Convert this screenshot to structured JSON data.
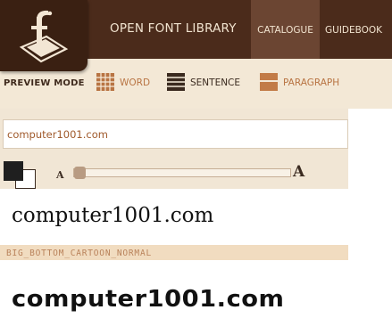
{
  "header": {
    "site_title": "OPEN FONT LIBRARY",
    "nav": [
      {
        "label": "CATALOGUE",
        "active": true
      },
      {
        "label": "GUIDEBOOK",
        "active": false
      }
    ]
  },
  "preview": {
    "mode_label": "PREVIEW MODE",
    "modes": [
      {
        "label": "WORD",
        "icon": "grid-icon"
      },
      {
        "label": "SENTENCE",
        "icon": "lines-icon"
      },
      {
        "label": "PARAGRAPH",
        "icon": "paragraph-icon"
      }
    ],
    "input_value": "computer1001.com",
    "foreground_color": "#1f1f1f",
    "background_color": "#ffffff",
    "size_small_label": "A",
    "size_large_label": "A"
  },
  "samples": {
    "default_text": "computer1001.com",
    "font_name": "BIG_BOTTOM_CARTOON_NORMAL",
    "font_text": "computer1001.com"
  },
  "colors": {
    "header_bg": "#4b2b1b",
    "accent": "#b87443",
    "panel_bg": "#f3e8d6"
  }
}
